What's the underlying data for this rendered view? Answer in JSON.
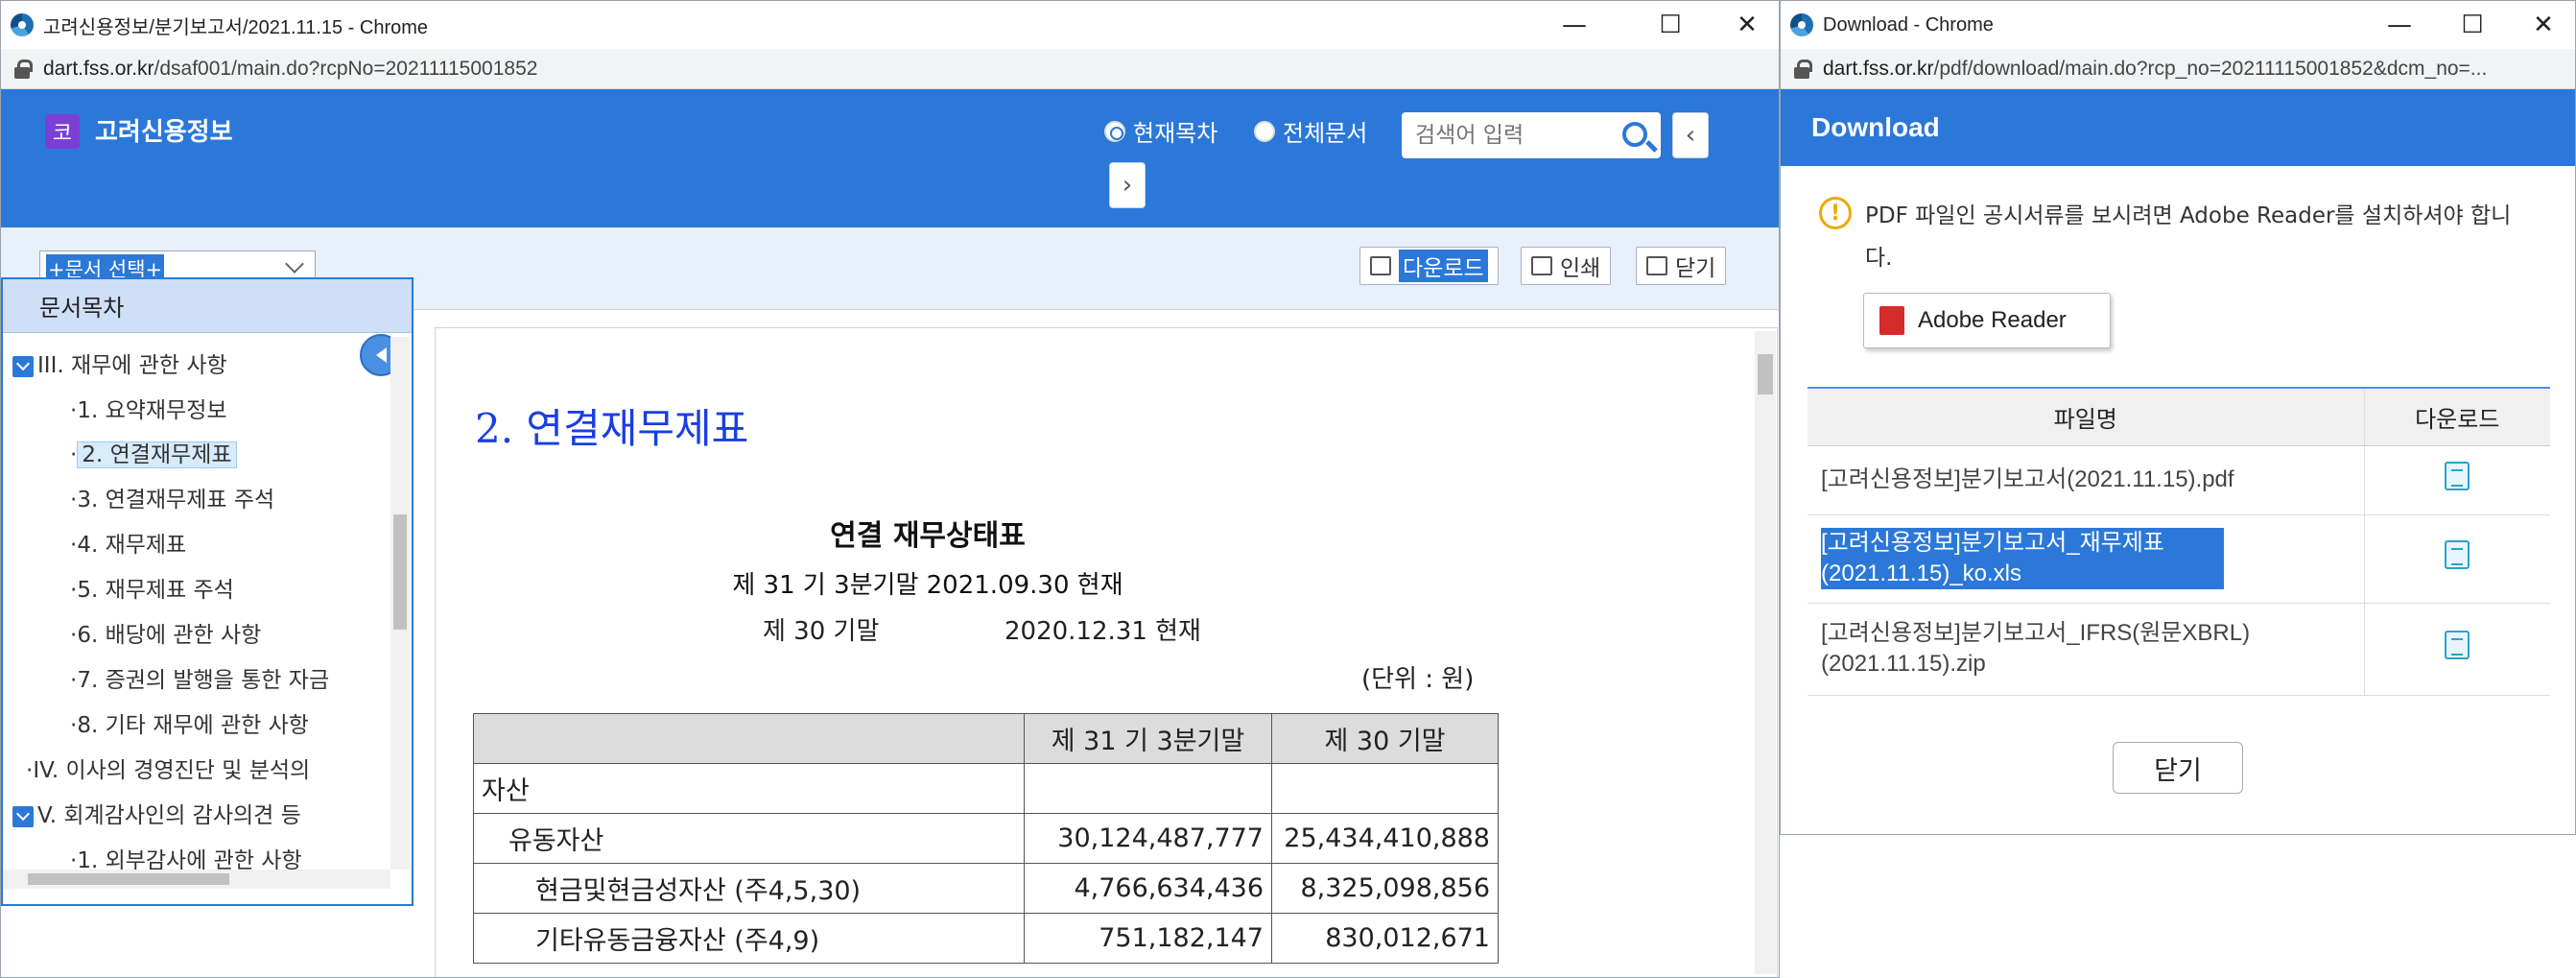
{
  "left_window": {
    "title": "고려신용정보/분기보고서/2021.11.15 - Chrome",
    "url_host": "dart.fss.or.kr",
    "url_path": "/dsaf001/main.do?rcpNo=20211115001852",
    "logo_char": "코",
    "brand": "고려신용정보",
    "radio_current": "현재목차",
    "radio_all": "전체문서",
    "search_placeholder": "검색어 입력",
    "doc_select": "+문서 선택+",
    "btn_download": "다운로드",
    "btn_print": "인쇄",
    "btn_close": "닫기",
    "toc_title": "문서목차",
    "toc": [
      "III. 재무에 관한 사항",
      "1. 요약재무정보",
      "2. 연결재무제표",
      "3. 연결재무제표 주석",
      "4. 재무제표",
      "5. 재무제표 주석",
      "6. 배당에 관한 사항",
      "7. 증권의 발행을 통한 자금",
      "8. 기타 재무에 관한 사항",
      "IV. 이사의 경영진단 및 분석의",
      "V. 회계감사인의 감사의견 등",
      "1. 외부감사에 관한 사항"
    ],
    "doc_heading": "2. 연결재무제표",
    "statement_title": "연결 재무상태표",
    "period1": "제 31 기 3분기말 2021.09.30 현재",
    "period2_label": "제 30 기말",
    "period2_date": "2020.12.31 현재",
    "unit": "(단위 : 원)",
    "table": {
      "headers": [
        "",
        "제 31 기 3분기말",
        "제 30 기말"
      ],
      "rows": [
        [
          "자산",
          "",
          ""
        ],
        [
          "유동자산",
          "30,124,487,777",
          "25,434,410,888"
        ],
        [
          "현금및현금성자산 (주4,5,30)",
          "4,766,634,436",
          "8,325,098,856"
        ],
        [
          "기타유동금융자산 (주4,9)",
          "751,182,147",
          "830,012,671"
        ]
      ]
    }
  },
  "right_window": {
    "title": "Download - Chrome",
    "url_host": "dart.fss.or.kr",
    "url_path": "/pdf/download/main.do?rcp_no=20211115001852&dcm_no=...",
    "heading": "Download",
    "notice": "PDF 파일인 공시서류를 보시려면 Adobe Reader를 설치하셔야 합니다.",
    "adobe_label": "Adobe Reader",
    "col_filename": "파일명",
    "col_download": "다운로드",
    "files": [
      "[고려신용정보]분기보고서(2021.11.15).pdf",
      "[고려신용정보]분기보고서_재무제표(2021.11.15)_ko.xls",
      "[고려신용정보]분기보고서_IFRS(원문XBRL)(2021.11.15).zip"
    ],
    "close_label": "닫기"
  },
  "colors": {
    "accent": "#2b78d9",
    "doc_heading": "#1a3ee0"
  }
}
